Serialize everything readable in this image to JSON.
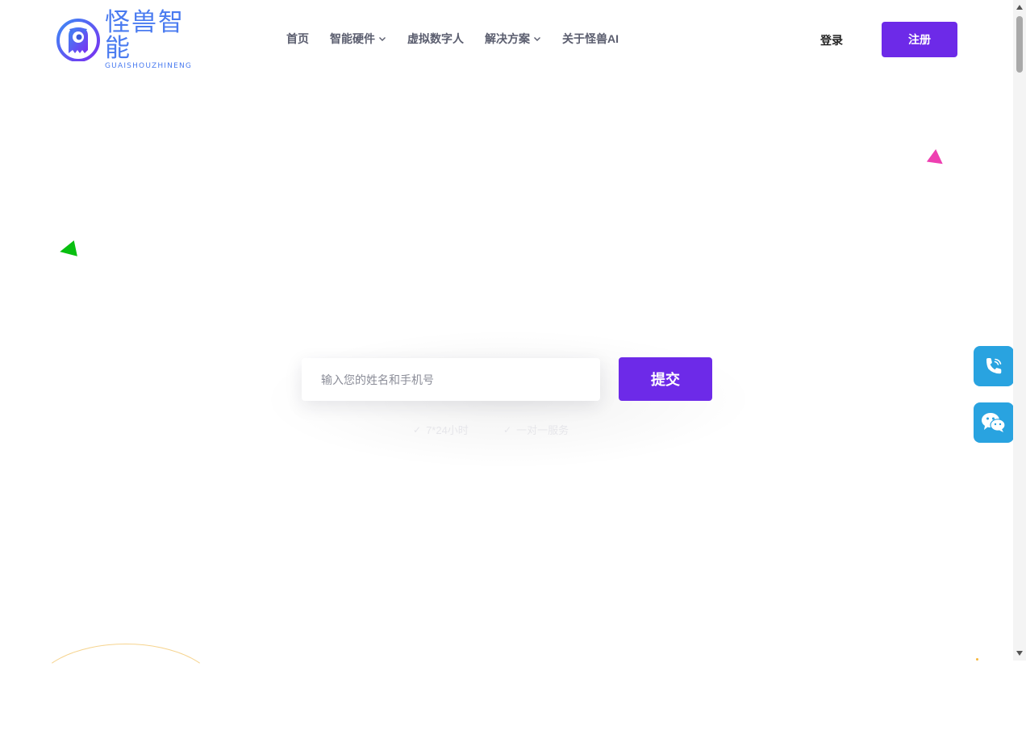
{
  "brand": {
    "name_cn": "怪兽智能",
    "name_en": "GUAISHOUZHINENG"
  },
  "nav": {
    "items": [
      {
        "label": "首页",
        "has_dropdown": false
      },
      {
        "label": "智能硬件",
        "has_dropdown": true
      },
      {
        "label": "虚拟数字人",
        "has_dropdown": false
      },
      {
        "label": "解决方案",
        "has_dropdown": true
      },
      {
        "label": "关于怪兽AI",
        "has_dropdown": false
      }
    ]
  },
  "auth": {
    "login_label": "登录",
    "register_label": "注册"
  },
  "contact_form": {
    "placeholder": "输入您的姓名和手机号",
    "value": "",
    "submit_label": "提交",
    "features": [
      "7*24小时",
      "一对一服务"
    ]
  },
  "float_buttons": [
    {
      "icon": "phone-icon"
    },
    {
      "icon": "wechat-icon"
    }
  ],
  "colors": {
    "accent": "#6d2ae8",
    "brand_blue": "#4a7bf0",
    "float_blue": "#29a3e0",
    "deco_pink": "#ee3fb1",
    "deco_green": "#08bf10"
  }
}
